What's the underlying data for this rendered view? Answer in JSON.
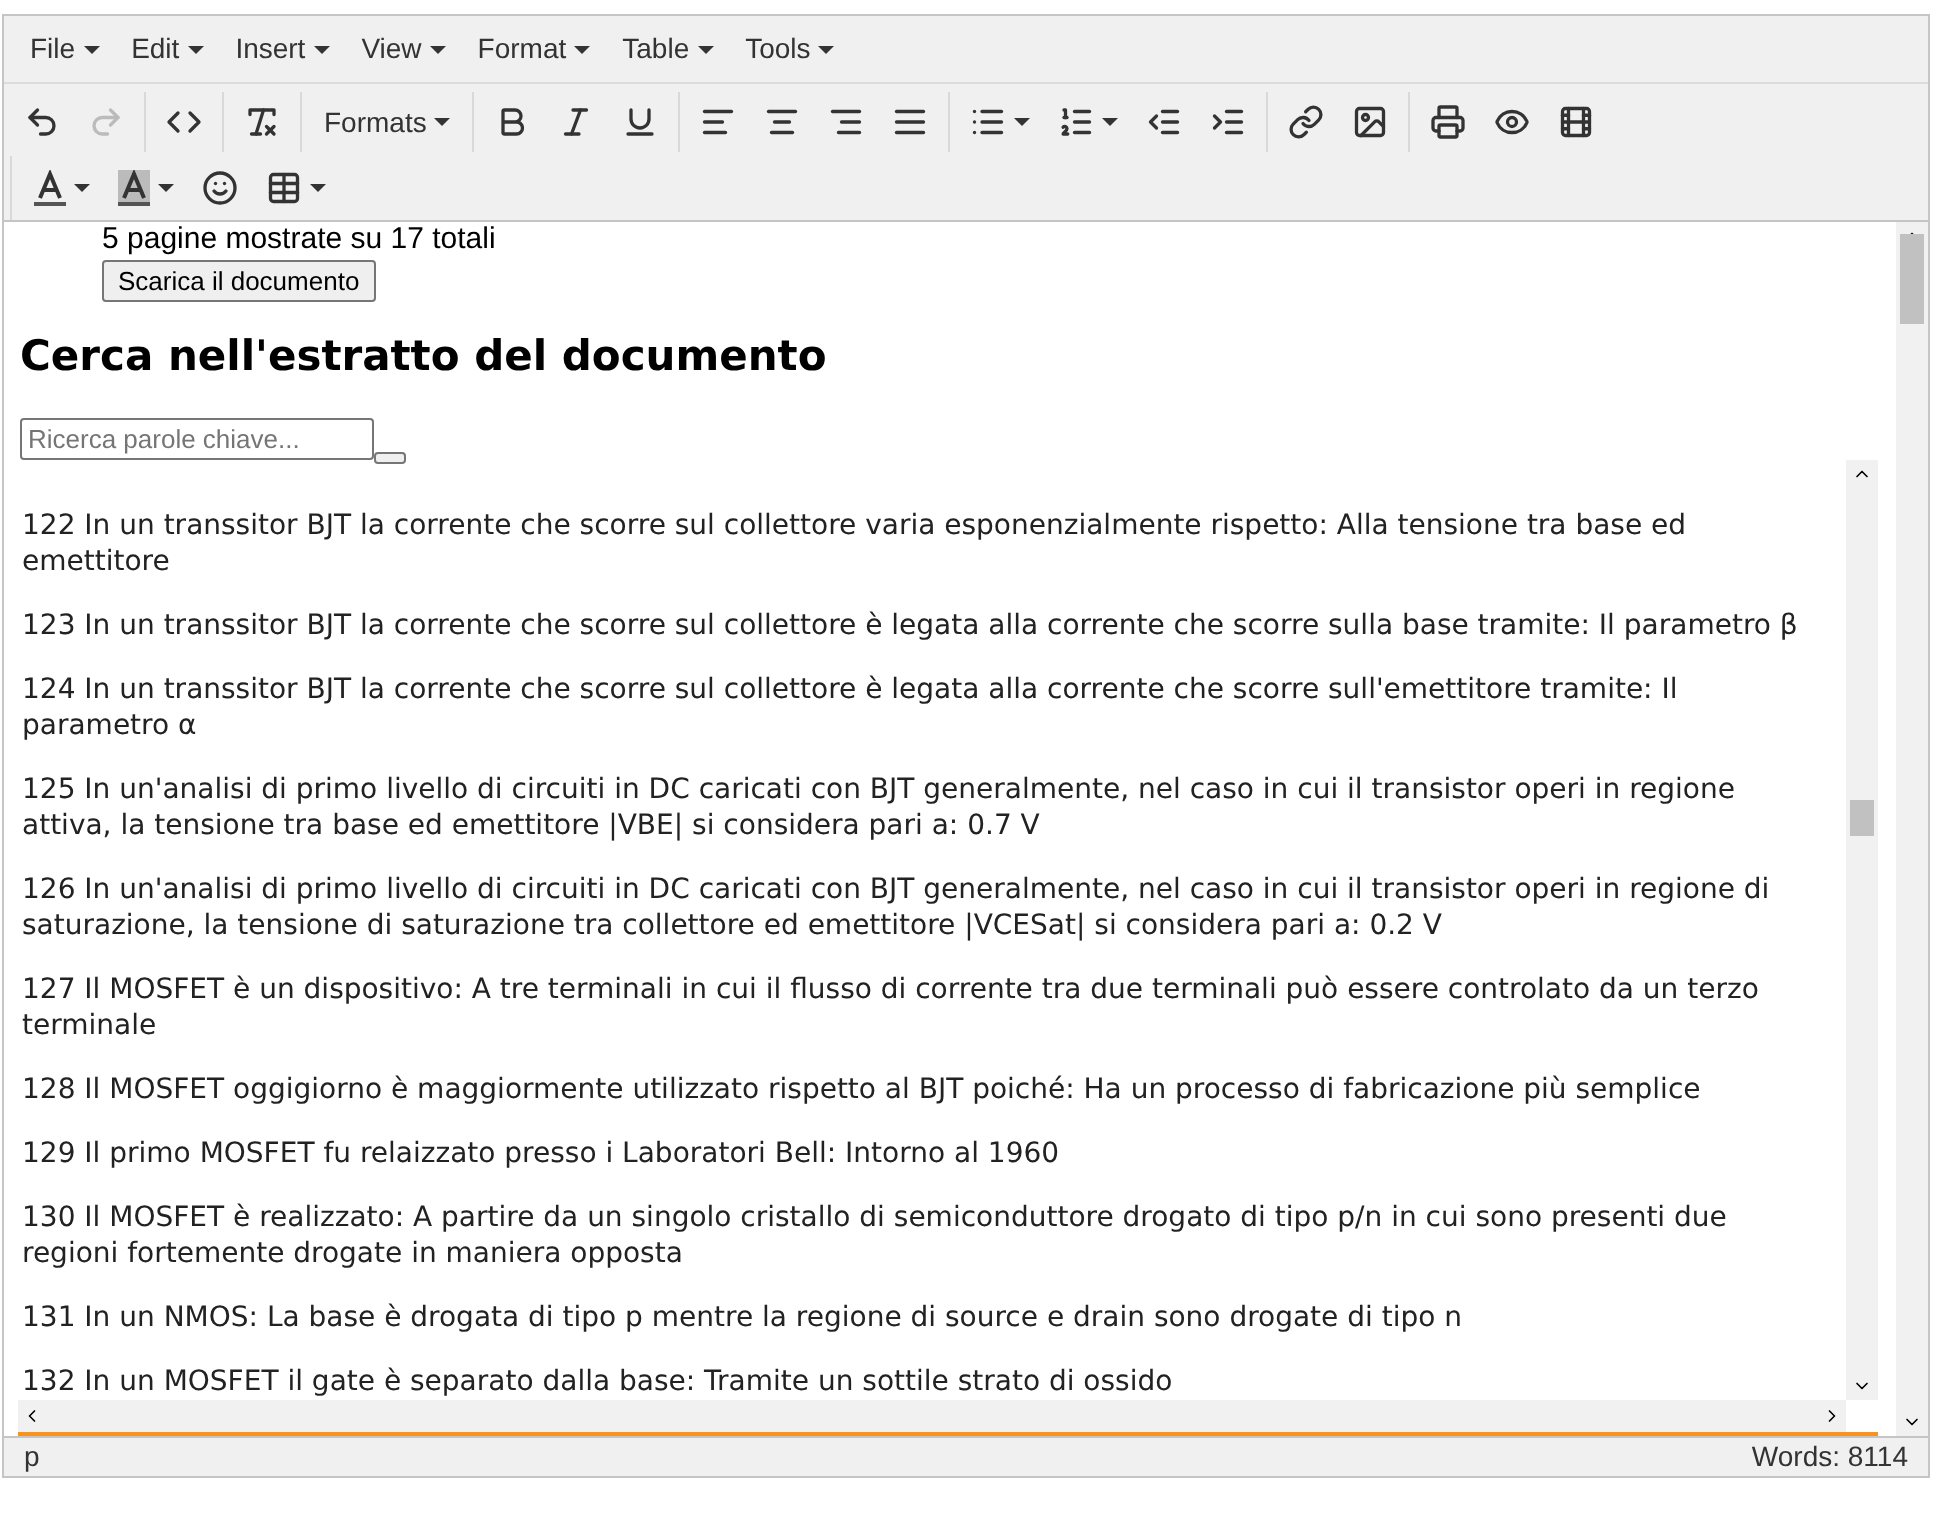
{
  "menu_bar": [
    {
      "label": "File"
    },
    {
      "label": "Edit"
    },
    {
      "label": "Insert"
    },
    {
      "label": "View"
    },
    {
      "label": "Format"
    },
    {
      "label": "Table"
    },
    {
      "label": "Tools"
    }
  ],
  "toolbar": {
    "undo": {
      "disabled": false
    },
    "redo": {
      "disabled": true
    },
    "formats": "Formats"
  },
  "content": {
    "pages_note": "5 pagine mostrate su 17 totali",
    "download_button": "Scarica il documento",
    "heading": "Cerca nell'estratto del documento",
    "search": {
      "placeholder": "Ricerca parole chiave..."
    },
    "paragraphs": [
      "122 In un transsitor BJT la corrente che scorre sul collettore varia esponenzialmente rispetto: Alla tensione tra base ed emettitore",
      "123 In un transsitor BJT la corrente che scorre sul collettore è legata alla corrente che scorre sulla base tramite: Il parametro β",
      "124 In un transsitor BJT la corrente che scorre sul collettore è legata alla corrente che scorre sull'emettitore tramite: Il parametro α",
      "125 In un'analisi di primo livello di circuiti in DC caricati con BJT generalmente, nel caso in cui il transistor operi in regione attiva, la tensione tra base ed emettitore |VBE| si considera pari a: 0.7 V",
      "126 In un'analisi di primo livello di circuiti in DC caricati con BJT generalmente, nel caso in cui il transistor operi in regione di saturazione, la tensione di saturazione tra collettore ed emettitore |VCESat| si considera pari a: 0.2 V",
      "127 Il MOSFET è un dispositivo: A tre terminali in cui il flusso di corrente tra due terminali può essere controlato da un terzo terminale",
      "128 Il MOSFET oggigiorno è maggiormente utilizzato rispetto al BJT poiché: Ha un processo di fabricazione più semplice",
      "129 Il primo MOSFET fu relaizzato presso i Laboratori Bell: Intorno al 1960",
      "130 Il MOSFET è realizzato: A partire da un singolo cristallo di semiconduttore drogato di tipo p/n in cui sono presenti due regioni fortemente drogate in maniera opposta",
      "131 In un NMOS: La base è drogata di tipo p mentre la regione di source e drain sono drogate di tipo n",
      "132 In un MOSFET il gate è separato dalla base: Tramite un sottile strato di ossido"
    ]
  },
  "status_bar": {
    "path": "p",
    "word_count": "Words: 8114"
  }
}
